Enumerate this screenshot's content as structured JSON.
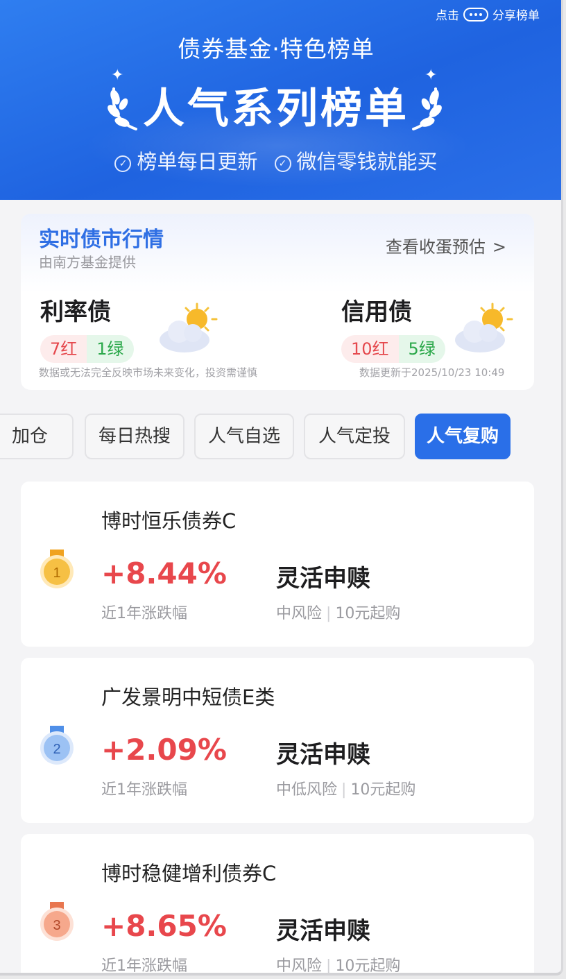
{
  "header": {
    "share_prefix": "点击",
    "share_label": "分享榜单",
    "subtitle": "债券基金·特色榜单",
    "title": "人气系列榜单",
    "tags": [
      "榜单每日更新",
      "微信零钱就能买"
    ]
  },
  "market": {
    "title": "实时债市行情",
    "source": "由南方基金提供",
    "link": "查看收蛋预估",
    "bonds": [
      {
        "name": "利率债",
        "red": "7红",
        "green": "1绿",
        "weather": "sunny-cloudy-icon"
      },
      {
        "name": "信用债",
        "red": "10红",
        "green": "5绿",
        "weather": "sunny-cloudy-icon"
      }
    ],
    "disclaimer": "数据或无法完全反映市场未来变化，投资需谨慎",
    "updated": "数据更新于2025/10/23 10:49"
  },
  "tabs": [
    "加仓",
    "每日热搜",
    "人气自选",
    "人气定投",
    "人气复购"
  ],
  "active_tab": "人气复购",
  "funds": [
    {
      "rank": "1",
      "name": "博时恒乐债券C",
      "return": "+8.44%",
      "return_label": "近1年涨跌幅",
      "redeem": "灵活申赎",
      "risk": "中风险",
      "min_buy": "10元起购",
      "medal": "gold"
    },
    {
      "rank": "2",
      "name": "广发景明中短债E类",
      "return": "+2.09%",
      "return_label": "近1年涨跌幅",
      "redeem": "灵活申赎",
      "risk": "中低风险",
      "min_buy": "10元起购",
      "medal": "silver"
    },
    {
      "rank": "3",
      "name": "博时稳健增利债券C",
      "return": "+8.65%",
      "return_label": "近1年涨跌幅",
      "redeem": "灵活申赎",
      "risk": "中风险",
      "min_buy": "10元起购",
      "medal": "bronze"
    }
  ],
  "colors": {
    "brand_blue": "#2a6fe8",
    "rise_red": "#e8474c",
    "fall_green": "#2ba84a",
    "medal_gold": "#f3b335",
    "medal_silver": "#6aa3ee",
    "medal_bronze": "#f08a6b"
  }
}
